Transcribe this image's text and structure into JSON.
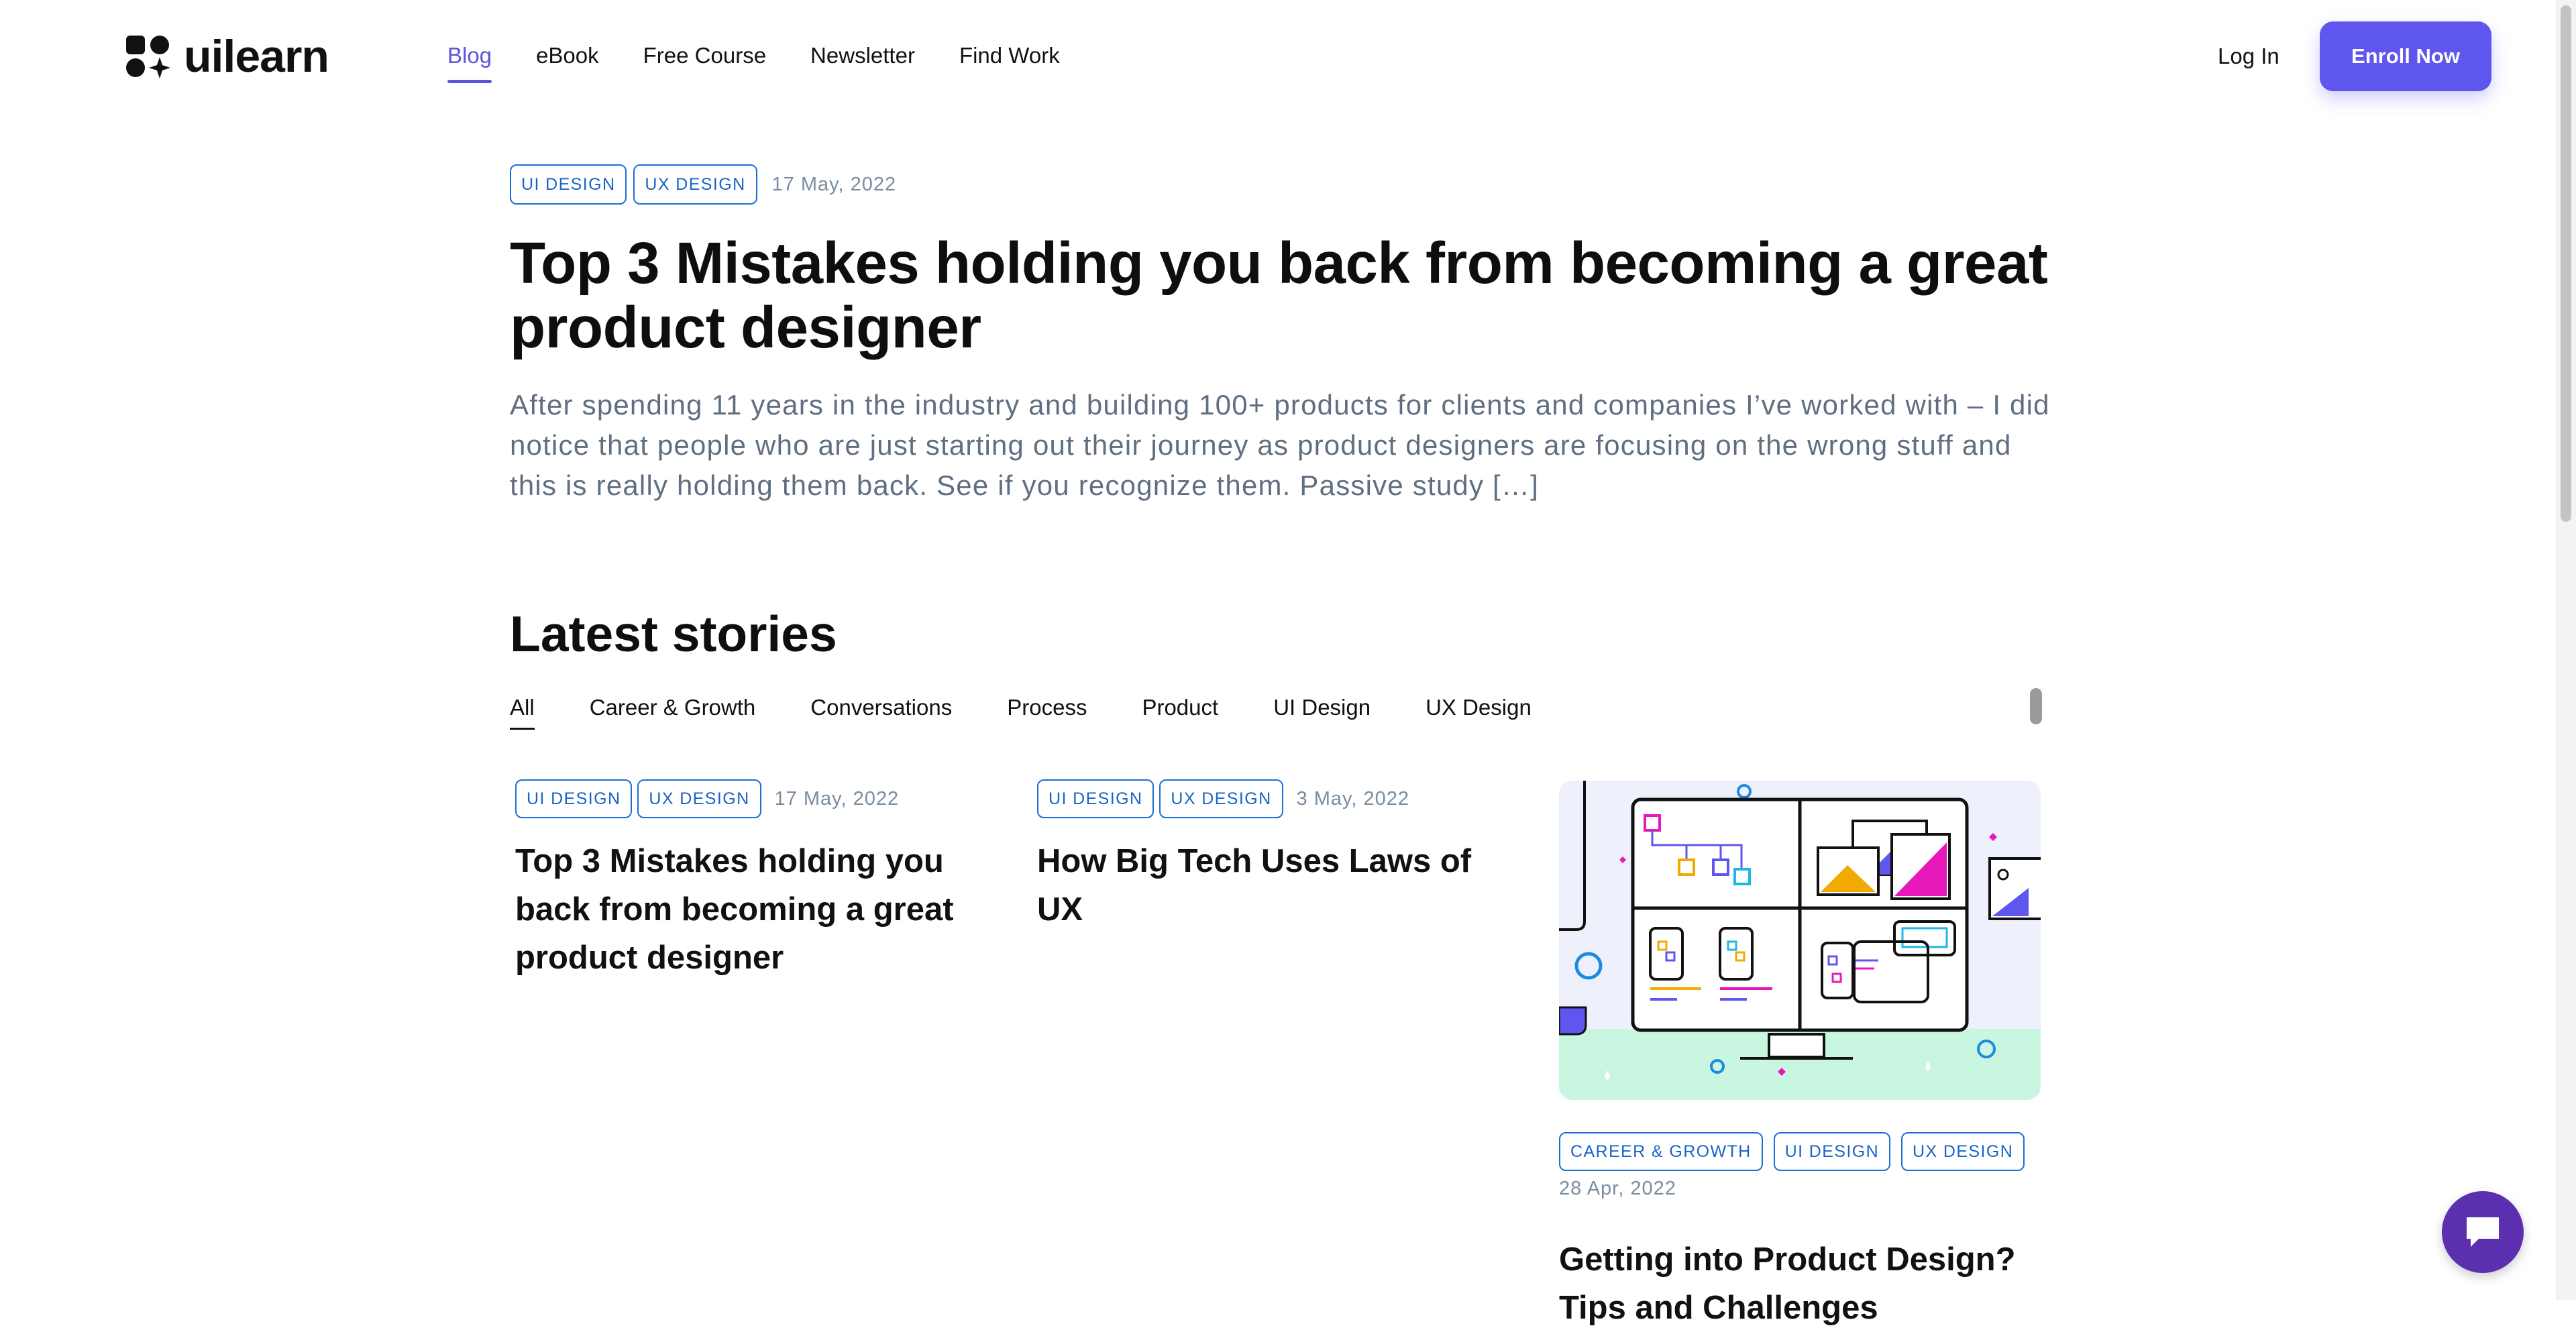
{
  "brand": {
    "name": "uilearn"
  },
  "nav": {
    "items": [
      {
        "label": "Blog",
        "active": true
      },
      {
        "label": "eBook"
      },
      {
        "label": "Free Course"
      },
      {
        "label": "Newsletter"
      },
      {
        "label": "Find Work"
      }
    ],
    "login_label": "Log In",
    "enroll_label": "Enroll Now"
  },
  "hero": {
    "tags": [
      "UI DESIGN",
      "UX DESIGN"
    ],
    "date": "17 May, 2022",
    "title": "Top 3 Mistakes holding you back from becoming a great product designer",
    "excerpt": "After spending 11 years in the industry and building 100+ products for clients and companies I’ve worked with – I did notice that people who are just starting out their journey as product designers are focusing on the wrong stuff and this is really holding them back.  See if you recognize them. Passive study […]"
  },
  "latest": {
    "title": "Latest stories",
    "filters": [
      {
        "label": "All",
        "active": true
      },
      {
        "label": "Career & Growth"
      },
      {
        "label": "Conversations"
      },
      {
        "label": "Process"
      },
      {
        "label": "Product"
      },
      {
        "label": "UI Design"
      },
      {
        "label": "UX Design"
      }
    ],
    "cards": [
      {
        "tags": [
          "UI DESIGN",
          "UX DESIGN"
        ],
        "date": "17 May, 2022",
        "title": "Top 3 Mistakes holding you back from becoming a great product designer"
      },
      {
        "tags": [
          "UI DESIGN",
          "UX DESIGN"
        ],
        "date": "3 May, 2022",
        "title": "How Big Tech Uses Laws of UX"
      },
      {
        "tags": [
          "CAREER & GROWTH",
          "UI DESIGN",
          "UX DESIGN"
        ],
        "date": "28 Apr, 2022",
        "title": "Getting into Product Design? Tips and Challenges"
      }
    ]
  },
  "colors": {
    "accent": "#5f55ef",
    "tag_blue": "#1a63c9",
    "muted_text": "#5f6e80",
    "chat_bubble": "#5c2fb0"
  },
  "icons": {
    "chat": "chat-bubble-icon",
    "logo": "uilearn-logo-icon"
  }
}
